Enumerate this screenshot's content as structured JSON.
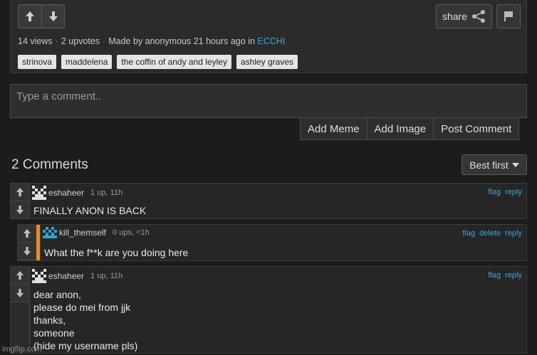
{
  "post": {
    "share_label": "share",
    "meta": {
      "views": "14 views",
      "upvotes": "2 upvotes",
      "made_by": "Made by anonymous 21 hours ago in",
      "stream": "ECCHI"
    },
    "tags": [
      "strinova",
      "maddelena",
      "the coffin of andy and leyley",
      "ashley graves"
    ]
  },
  "comment_box": {
    "placeholder": "Type a comment..",
    "actions": [
      "Add Meme",
      "Add Image",
      "Post Comment"
    ]
  },
  "comments_section": {
    "heading": "2 Comments",
    "sort_label": "Best first"
  },
  "comments": [
    {
      "user": "eshaheer",
      "points": "1 up, 11h",
      "links": [
        "flag",
        "reply"
      ],
      "text": "FINALLY ANON IS BACK",
      "avatar_color": "#e0e0e0"
    },
    {
      "user": "kill_themself",
      "points": "0 ups, <1h",
      "links": [
        "flag",
        "delete",
        "reply"
      ],
      "text": "What the f**k are you doing here",
      "avatar_color": "#2ea3d8",
      "accent": "#f08a1c"
    },
    {
      "user": "eshaheer",
      "points": "1 up, 11h",
      "links": [
        "flag",
        "reply"
      ],
      "text": "dear anon,\nplease do mei from jjk\nthanks,\nsomeone\n(hide my username pls)",
      "avatar_color": "#e0e0e0"
    }
  ],
  "watermark": "imgflip.com"
}
